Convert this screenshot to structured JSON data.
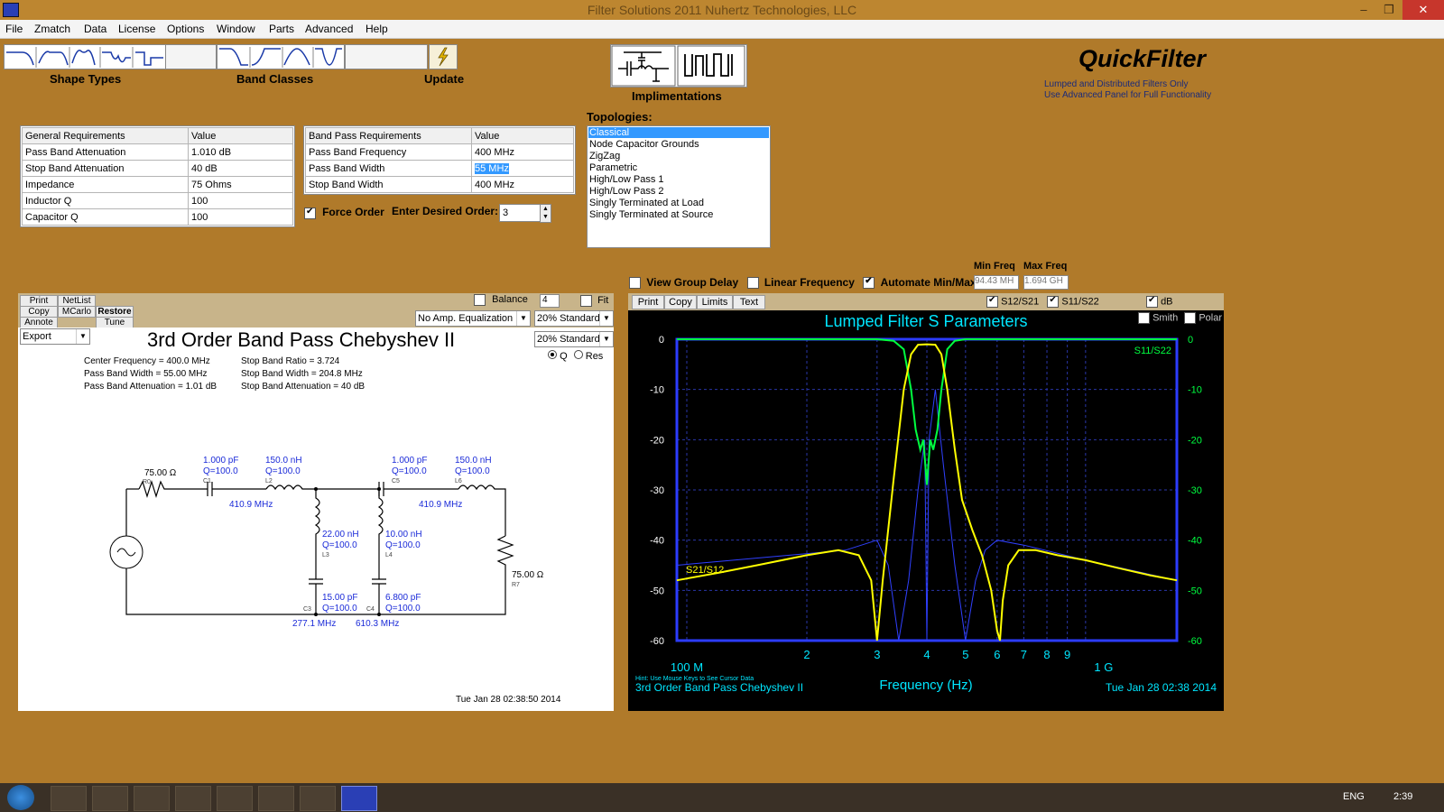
{
  "window": {
    "title": "Filter Solutions 2011      Nuhertz Technologies, LLC",
    "minimize": "–",
    "restore": "❐",
    "close": "✕"
  },
  "menu": [
    "File",
    "Zmatch",
    "Data",
    "License",
    "Options",
    "Window",
    "Parts",
    "Advanced",
    "Help"
  ],
  "toolbar": {
    "shape_types": "Shape Types",
    "band_classes": "Band Classes",
    "update": "Update",
    "implementations": "Implimentations"
  },
  "brand": {
    "name": "QuickFilter",
    "line1": "Lumped and Distributed Filters Only",
    "line2": "Use Advanced Panel for Full Functionality"
  },
  "general_requirements": {
    "headers": [
      "General Requirements",
      "Value"
    ],
    "rows": [
      [
        "Pass Band Attenuation",
        "1.010 dB"
      ],
      [
        "Stop Band Attenuation",
        "40 dB"
      ],
      [
        "Impedance",
        "75 Ohms"
      ],
      [
        "Inductor Q",
        "100"
      ],
      [
        "Capacitor Q",
        "100"
      ]
    ]
  },
  "band_pass_requirements": {
    "headers": [
      "Band Pass Requirements",
      "Value"
    ],
    "rows": [
      [
        "Pass Band Frequency",
        "400 MHz"
      ],
      [
        "Pass Band Width",
        "55 MHz"
      ],
      [
        "Stop Band Width",
        "400 MHz"
      ]
    ]
  },
  "force_order": {
    "label": "Force Order",
    "checked": true,
    "order_label": "Enter Desired Order:",
    "order_value": "3"
  },
  "topologies": {
    "label": "Topologies:",
    "selected": "Classical",
    "items": [
      "Classical",
      "Node Capacitor Grounds",
      "ZigZag",
      "Parametric",
      "High/Low Pass 1",
      "High/Low Pass 2",
      "Singly Terminated at Load",
      "Singly Terminated at Source"
    ]
  },
  "schematic": {
    "buttons": {
      "print": "Print",
      "copy": "Copy",
      "annote": "Annote",
      "netlist": "NetList",
      "mcarlo": "MCarlo",
      "restore": "Restore",
      "tune": "Tune"
    },
    "export": "Export",
    "balance": "Balance",
    "balance_value": "4",
    "fit": "Fit",
    "equalization": "No Amp. Equalization",
    "std1": "20% Standard",
    "std2": "20% Standard",
    "radio_q": "Q",
    "radio_res": "Res",
    "title": "3rd Order Band Pass Chebyshev II",
    "info_left": [
      "Center Frequency = 400.0 MHz",
      "Pass Band Width = 55.00 MHz",
      "Pass Band Attenuation = 1.01 dB"
    ],
    "info_right": [
      "Stop Band Ratio = 3.724",
      "Stop Band Width = 204.8 MHz",
      "Stop Band Attenuation = 40 dB"
    ],
    "timestamp": "Tue Jan 28 02:38:50 2014",
    "parts": {
      "r0": "75.00 Ω",
      "r0_id": "R0",
      "c1": "1.000 pF",
      "c1_q": "Q=100.0",
      "c1_id": "C1",
      "l2": "150.0 nH",
      "l2_q": "Q=100.0",
      "l2_id": "L2",
      "f1": "410.9 MHz",
      "l3": "22.00 nH",
      "l3_q": "Q=100.0",
      "l3_id": "L3",
      "c3": "15.00 pF",
      "c3_q": "Q=100.0",
      "c3_id": "C3",
      "f2": "277.1 MHz",
      "l4": "10.00 nH",
      "l4_q": "Q=100.0",
      "l4_id": "L4",
      "c4": "6.800 pF",
      "c4_q": "Q=100.0",
      "c4_id": "C4",
      "f3": "610.3 MHz",
      "c5": "1.000 pF",
      "c5_q": "Q=100.0",
      "c5_id": "C5",
      "l6": "150.0 nH",
      "l6_q": "Q=100.0",
      "l6_id": "L6",
      "f4": "410.9 MHz",
      "r7": "75.00 Ω",
      "r7_id": "R7"
    }
  },
  "plot_controls": {
    "group_delay": "View Group Delay",
    "group_delay_checked": false,
    "linear_freq": "Linear Frequency",
    "linear_freq_checked": false,
    "automate": "Automate Min/Max",
    "automate_checked": true,
    "min_freq_label": "Min Freq",
    "min_freq": "94.43 MH",
    "max_freq_label": "Max Freq",
    "max_freq": "1.694 GH",
    "buttons": [
      "Print",
      "Copy",
      "Limits",
      "Text"
    ],
    "s12": "S12/S21",
    "s11": "S11/S22",
    "db": "dB",
    "smith": "Smith",
    "polar": "Polar"
  },
  "chart_data": {
    "type": "line",
    "title": "Lumped Filter S Parameters",
    "xlabel": "Frequency (Hz)",
    "x_scale": "log",
    "xlim_mhz": [
      94.43,
      1694
    ],
    "ylim": [
      -60,
      0
    ],
    "x_ticks": [
      "100 M",
      "2",
      "3",
      "4",
      "5",
      "6",
      "7",
      "8",
      "9",
      "1 G"
    ],
    "y_ticks": [
      "0",
      "-10",
      "-20",
      "-30",
      "-40",
      "-50",
      "-60"
    ],
    "grid": true,
    "hint": "Hint: Use Mouse Keys to See Cursor Data",
    "footer_left": "3rd Order Band Pass Chebyshev II",
    "footer_right": "Tue Jan 28 02:38 2014",
    "series": [
      {
        "name": "S21/S12",
        "color": "#ffff00",
        "x": [
          94.43,
          120,
          150,
          200,
          240,
          270,
          290,
          300,
          310,
          330,
          350,
          365,
          380,
          400,
          420,
          435,
          450,
          470,
          490,
          520,
          550,
          580,
          600,
          610,
          620,
          640,
          680,
          750,
          850,
          1000,
          1200,
          1450,
          1694
        ],
        "y": [
          -48,
          -46.5,
          -45,
          -43,
          -42,
          -43,
          -48,
          -60,
          -48,
          -28,
          -10,
          -3,
          -1.1,
          -1.0,
          -1.1,
          -3,
          -10,
          -22,
          -32,
          -38,
          -43,
          -50,
          -58,
          -60,
          -52,
          -45,
          -42,
          -42,
          -43,
          -44,
          -45.5,
          -47,
          -48
        ]
      },
      {
        "name": "S11/S22",
        "color": "#00ff40",
        "x": [
          94.43,
          200,
          300,
          330,
          350,
          365,
          375,
          385,
          392,
          400,
          408,
          415,
          425,
          435,
          450,
          470,
          500,
          600,
          1000,
          1694
        ],
        "y": [
          0,
          0,
          0,
          -0.3,
          -2,
          -10,
          -18,
          -22,
          -20,
          -29,
          -20,
          -22,
          -18,
          -10,
          -2,
          -0.3,
          0,
          0,
          0,
          0
        ]
      },
      {
        "name": "",
        "color": "#3040ff",
        "x": [
          94.43,
          250,
          300,
          320,
          340,
          360,
          380,
          395,
          400,
          405,
          420,
          440,
          470,
          500,
          530,
          560,
          600,
          700,
          1000,
          1694
        ],
        "y": [
          -45,
          -42,
          -40,
          -45,
          -60,
          -48,
          -30,
          -20,
          -60,
          -20,
          -10,
          -25,
          -45,
          -60,
          -48,
          -42,
          -40,
          -41,
          -44,
          -48
        ]
      }
    ],
    "right_label": "S11/S22",
    "left_label": "S21/S12"
  },
  "taskbar": {
    "lang": "ENG",
    "time": "2:39"
  }
}
